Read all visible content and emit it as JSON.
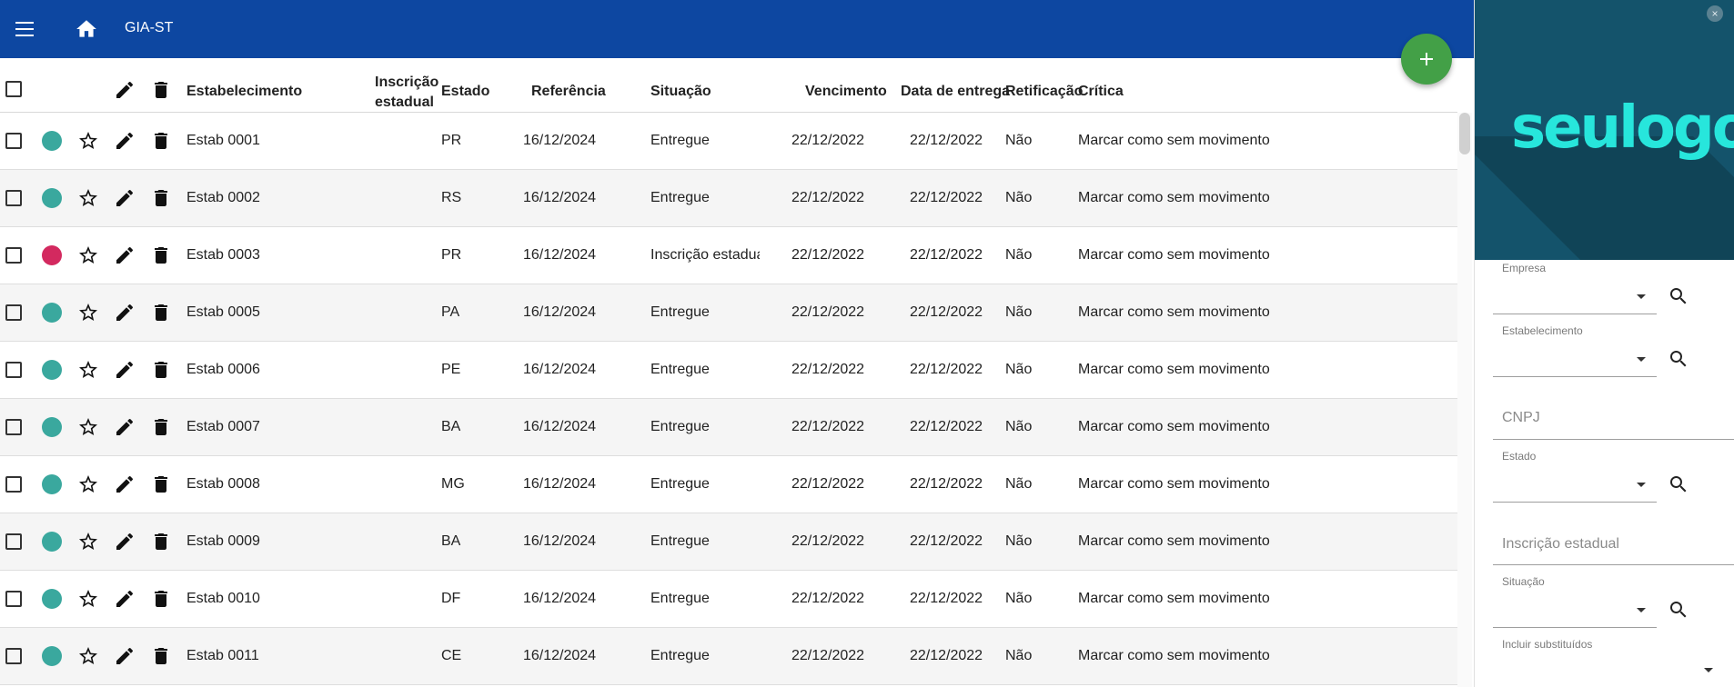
{
  "header": {
    "title": "GIA-ST",
    "menu_icon": "menu-icon",
    "home_icon": "home-icon",
    "color": "#0d47a1"
  },
  "fab": {
    "icon": "plus-icon",
    "color": "#43a047"
  },
  "table": {
    "columns": {
      "estabelecimento": "Estabelecimento",
      "inscricao_line1": "Inscrição",
      "inscricao_line2": "estadual",
      "estado": "Estado",
      "referencia": "Referência",
      "situacao": "Situação",
      "vencimento": "Vencimento",
      "data_entrega": "Data de entrega",
      "retificacao": "Retificação",
      "critica": "Crítica"
    },
    "status_colors": {
      "ok": "#3aa89e",
      "error": "#d3295f"
    },
    "rows": [
      {
        "estab": "Estab 0001",
        "estado": "PR",
        "referencia": "16/12/2024",
        "situacao": "Entregue",
        "vencimento": "22/12/2022",
        "data_entrega": "22/12/2022",
        "retificacao": "Não",
        "critica": "Marcar como sem movimento",
        "status": "ok"
      },
      {
        "estab": "Estab 0002",
        "estado": "RS",
        "referencia": "16/12/2024",
        "situacao": "Entregue",
        "vencimento": "22/12/2022",
        "data_entrega": "22/12/2022",
        "retificacao": "Não",
        "critica": "Marcar como sem movimento",
        "status": "ok"
      },
      {
        "estab": "Estab 0003",
        "estado": "PR",
        "referencia": "16/12/2024",
        "situacao": "Inscrição estadual",
        "vencimento": "22/12/2022",
        "data_entrega": "22/12/2022",
        "retificacao": "Não",
        "critica": "Marcar como sem movimento",
        "status": "error"
      },
      {
        "estab": "Estab 0005",
        "estado": "PA",
        "referencia": "16/12/2024",
        "situacao": "Entregue",
        "vencimento": "22/12/2022",
        "data_entrega": "22/12/2022",
        "retificacao": "Não",
        "critica": "Marcar como sem movimento",
        "status": "ok"
      },
      {
        "estab": "Estab 0006",
        "estado": "PE",
        "referencia": "16/12/2024",
        "situacao": "Entregue",
        "vencimento": "22/12/2022",
        "data_entrega": "22/12/2022",
        "retificacao": "Não",
        "critica": "Marcar como sem movimento",
        "status": "ok"
      },
      {
        "estab": "Estab 0007",
        "estado": "BA",
        "referencia": "16/12/2024",
        "situacao": "Entregue",
        "vencimento": "22/12/2022",
        "data_entrega": "22/12/2022",
        "retificacao": "Não",
        "critica": "Marcar como sem movimento",
        "status": "ok"
      },
      {
        "estab": "Estab 0008",
        "estado": "MG",
        "referencia": "16/12/2024",
        "situacao": "Entregue",
        "vencimento": "22/12/2022",
        "data_entrega": "22/12/2022",
        "retificacao": "Não",
        "critica": "Marcar como sem movimento",
        "status": "ok"
      },
      {
        "estab": "Estab 0009",
        "estado": "BA",
        "referencia": "16/12/2024",
        "situacao": "Entregue",
        "vencimento": "22/12/2022",
        "data_entrega": "22/12/2022",
        "retificacao": "Não",
        "critica": "Marcar como sem movimento",
        "status": "ok"
      },
      {
        "estab": "Estab 0010",
        "estado": "DF",
        "referencia": "16/12/2024",
        "situacao": "Entregue",
        "vencimento": "22/12/2022",
        "data_entrega": "22/12/2022",
        "retificacao": "Não",
        "critica": "Marcar como sem movimento",
        "status": "ok"
      },
      {
        "estab": "Estab 0011",
        "estado": "CE",
        "referencia": "16/12/2024",
        "situacao": "Entregue",
        "vencimento": "22/12/2022",
        "data_entrega": "22/12/2022",
        "retificacao": "Não",
        "critica": "Marcar como sem movimento",
        "status": "ok"
      }
    ]
  },
  "sidepanel": {
    "logo_text": "seulogo",
    "logo_bg": "#14536b",
    "logo_color": "#27e6dc",
    "close_label": "×",
    "filters": {
      "empresa_label": "Empresa",
      "estabelecimento_label": "Estabelecimento",
      "cnpj_placeholder": "CNPJ",
      "estado_label": "Estado",
      "inscricao_placeholder": "Inscrição estadual",
      "situacao_label": "Situação",
      "incluir_label": "Incluir substituídos"
    }
  }
}
